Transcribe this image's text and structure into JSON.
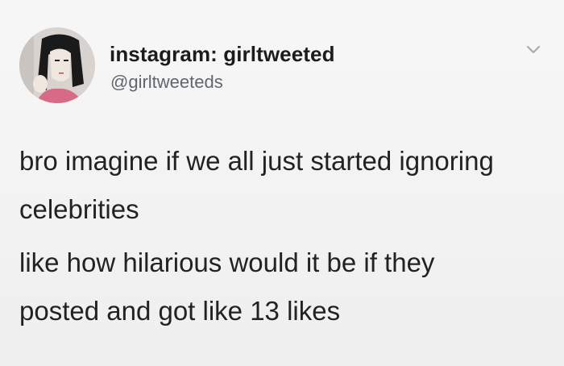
{
  "tweet": {
    "display_name": "instagram: girltweeted",
    "handle": "@girltweeteds",
    "avatar_icon": "cartoon-girl-avatar",
    "menu_icon": "chevron-down-icon",
    "paragraphs": [
      {
        "lines": [
          "bro imagine if we all just started ignoring",
          "celebrities"
        ]
      },
      {
        "lines": [
          "like how hilarious would it be if they",
          "posted and got like 13 likes"
        ]
      }
    ]
  }
}
